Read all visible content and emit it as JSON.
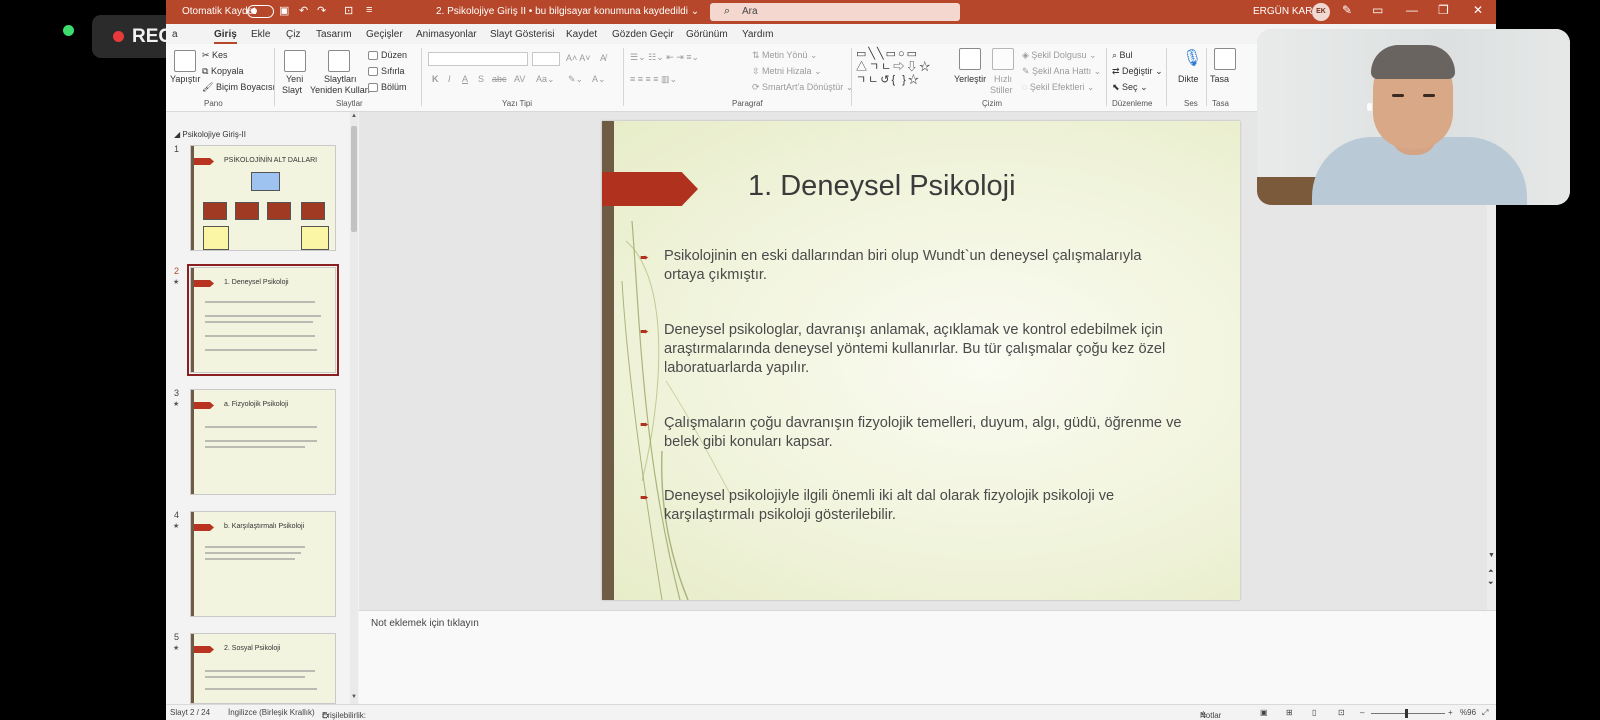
{
  "recording": {
    "label": "REC"
  },
  "titlebar": {
    "autosave_label": "Otomatik Kaydet",
    "document_title": "2. Psikolojiye Giriş II  •  bu bilgisayar konumuna kaydedildi ⌄",
    "search_placeholder": "Ara",
    "user_name": "ERGÜN KARA",
    "user_initials": "EK"
  },
  "tabs": [
    "Giriş",
    "Ekle",
    "Çiz",
    "Tasarım",
    "Geçişler",
    "Animasyonlar",
    "Slayt Gösterisi",
    "Kaydet",
    "Gözden Geçir",
    "Görünüm",
    "Yardım"
  ],
  "tabs_partial_first": "a",
  "ribbon": {
    "pano": {
      "paste": "Yapıştır",
      "cut": "Kes",
      "copy": "Kopyala",
      "format_painter": "Biçim Boyacısı",
      "label": "Pano"
    },
    "slaytlar": {
      "new_slide": "Yeni",
      "new_slide2": "Slayt",
      "reuse": "Slaytları",
      "reuse2": "Yeniden Kullan",
      "layout": "Düzen",
      "reset": "Sıfırla",
      "section": "Bölüm",
      "label": "Slaytlar"
    },
    "yazi_tipi": {
      "label": "Yazı Tipi"
    },
    "paragraf": {
      "text_direction": "Metin Yönü",
      "align_text": "Metni Hizala",
      "smartart": "SmartArt'a Dönüştür",
      "label": "Paragraf"
    },
    "cizim": {
      "arrange": "Yerleştir",
      "quick_styles": "Hızlı",
      "quick_styles2": "Stiller",
      "shape_fill": "Şekil Dolgusu",
      "shape_outline": "Şekil Ana Hattı",
      "shape_effects": "Şekil Efektleri",
      "label": "Çizim"
    },
    "duzenleme": {
      "find": "Bul",
      "replace": "Değiştir",
      "select": "Seç",
      "label": "Düzenleme"
    },
    "ses": {
      "dictate": "Dikte",
      "label": "Ses"
    },
    "tasarimci": {
      "label": "Tasa"
    }
  },
  "thumbs": {
    "section_title": "Psikolojiye Giriş-II",
    "slides": [
      {
        "num": "1",
        "title": "PSİKOLOJİNİN   ALT DALLARI"
      },
      {
        "num": "2",
        "title": "1. Deneysel Psikoloji"
      },
      {
        "num": "3",
        "title": "a. Fizyolojik Psikoloji"
      },
      {
        "num": "4",
        "title": "b. Karşılaştırmalı Psikoloji"
      },
      {
        "num": "5",
        "title": "2. Sosyal Psikoloji"
      }
    ]
  },
  "slide": {
    "title": "1. Deneysel Psikoloji",
    "bullets": [
      "Psikolojinin en eski dallarından biri olup Wundt`un deneysel çalışmalarıyla ortaya çıkmıştır.",
      "Deneysel psikologlar, davranışı anlamak, açıklamak ve kontrol edebilmek için araştırmalarında deneysel yöntemi kullanırlar. Bu tür çalışmalar çoğu kez özel laboratuarlarda yapılır.",
      "Çalışmaların çoğu davranışın fizyolojik temelleri, duyum, algı, güdü, öğrenme ve belek gibi konuları kapsar.",
      "Deneysel psikolojiyle ilgili önemli iki alt dal olarak fizyolojik psikoloji ve karşılaştırmalı psikoloji gösterilebilir."
    ]
  },
  "notes": {
    "placeholder": "Not eklemek için tıklayın"
  },
  "statusbar": {
    "slide_info": "Slayt 2 / 24",
    "language": "İngilizce (Birleşik Krallık)",
    "accessibility": "Erişilebilirlik: Önerilere göz atın",
    "notes_btn": "Notlar",
    "zoom": "%96"
  },
  "colors": {
    "accent": "#b7472a",
    "slide_arrow": "#b0311d",
    "slide_bar": "#6e5c45"
  }
}
